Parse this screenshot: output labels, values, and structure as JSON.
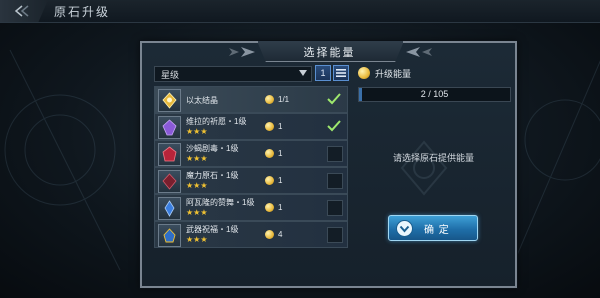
{
  "page": {
    "title": "原石升级"
  },
  "dialog": {
    "title": "选择能量",
    "filter": {
      "selected": "星级"
    },
    "sort": {
      "order_label": "1"
    },
    "items": [
      {
        "name": "以太结晶",
        "stars": "",
        "cost": "1/1",
        "checked": true,
        "gem": "gold"
      },
      {
        "name": "维拉的祈愿・1级",
        "stars": "★★★",
        "cost": "1",
        "checked": true,
        "gem": "purple"
      },
      {
        "name": "沙蝎剧毒・1级",
        "stars": "★★★",
        "cost": "1",
        "checked": false,
        "gem": "red"
      },
      {
        "name": "魔力原石・1级",
        "stars": "★★★",
        "cost": "1",
        "checked": false,
        "gem": "darkred"
      },
      {
        "name": "阿瓦隆的赞舞・1级",
        "stars": "★★★",
        "cost": "1",
        "checked": false,
        "gem": "blue"
      },
      {
        "name": "武器祝福・1级",
        "stars": "★★★",
        "cost": "4",
        "checked": false,
        "gem": "blue2"
      }
    ],
    "energy": {
      "label": "升级能量",
      "progress": "2 / 105",
      "current": 2,
      "max": 105
    },
    "hint": "请选择原石提供能量",
    "confirm_label": "确 定"
  },
  "colors": {
    "accent": "#3ea0d6",
    "star": "#f1c232",
    "check": "#9ee86d"
  }
}
